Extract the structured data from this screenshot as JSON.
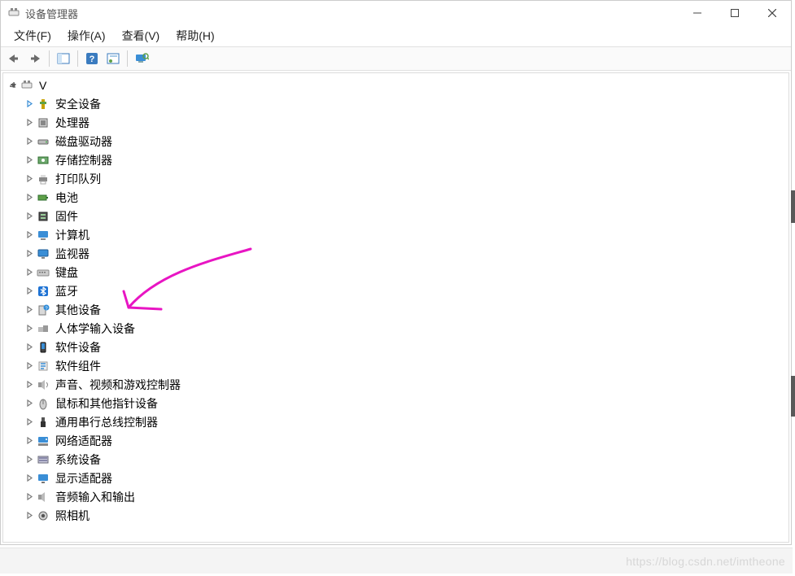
{
  "window": {
    "title": "设备管理器"
  },
  "menu": {
    "file": "文件(F)",
    "action": "操作(A)",
    "view": "查看(V)",
    "help": "帮助(H)"
  },
  "tree": {
    "root_label": "V",
    "items": [
      {
        "label": "安全设备",
        "icon": "security"
      },
      {
        "label": "处理器",
        "icon": "cpu"
      },
      {
        "label": "磁盘驱动器",
        "icon": "disk"
      },
      {
        "label": "存储控制器",
        "icon": "storage-ctrl"
      },
      {
        "label": "打印队列",
        "icon": "printer"
      },
      {
        "label": "电池",
        "icon": "battery"
      },
      {
        "label": "固件",
        "icon": "firmware"
      },
      {
        "label": "计算机",
        "icon": "computer"
      },
      {
        "label": "监视器",
        "icon": "monitor"
      },
      {
        "label": "键盘",
        "icon": "keyboard"
      },
      {
        "label": "蓝牙",
        "icon": "bluetooth"
      },
      {
        "label": "其他设备",
        "icon": "other"
      },
      {
        "label": "人体学输入设备",
        "icon": "hid"
      },
      {
        "label": "软件设备",
        "icon": "soft-dev"
      },
      {
        "label": "软件组件",
        "icon": "soft-comp"
      },
      {
        "label": "声音、视频和游戏控制器",
        "icon": "audio"
      },
      {
        "label": "鼠标和其他指针设备",
        "icon": "mouse"
      },
      {
        "label": "通用串行总线控制器",
        "icon": "usb"
      },
      {
        "label": "网络适配器",
        "icon": "network"
      },
      {
        "label": "系统设备",
        "icon": "system"
      },
      {
        "label": "显示适配器",
        "icon": "display"
      },
      {
        "label": "音频输入和输出",
        "icon": "speaker"
      },
      {
        "label": "照相机",
        "icon": "camera"
      }
    ]
  },
  "watermark": "https://blog.csdn.net/imtheone"
}
